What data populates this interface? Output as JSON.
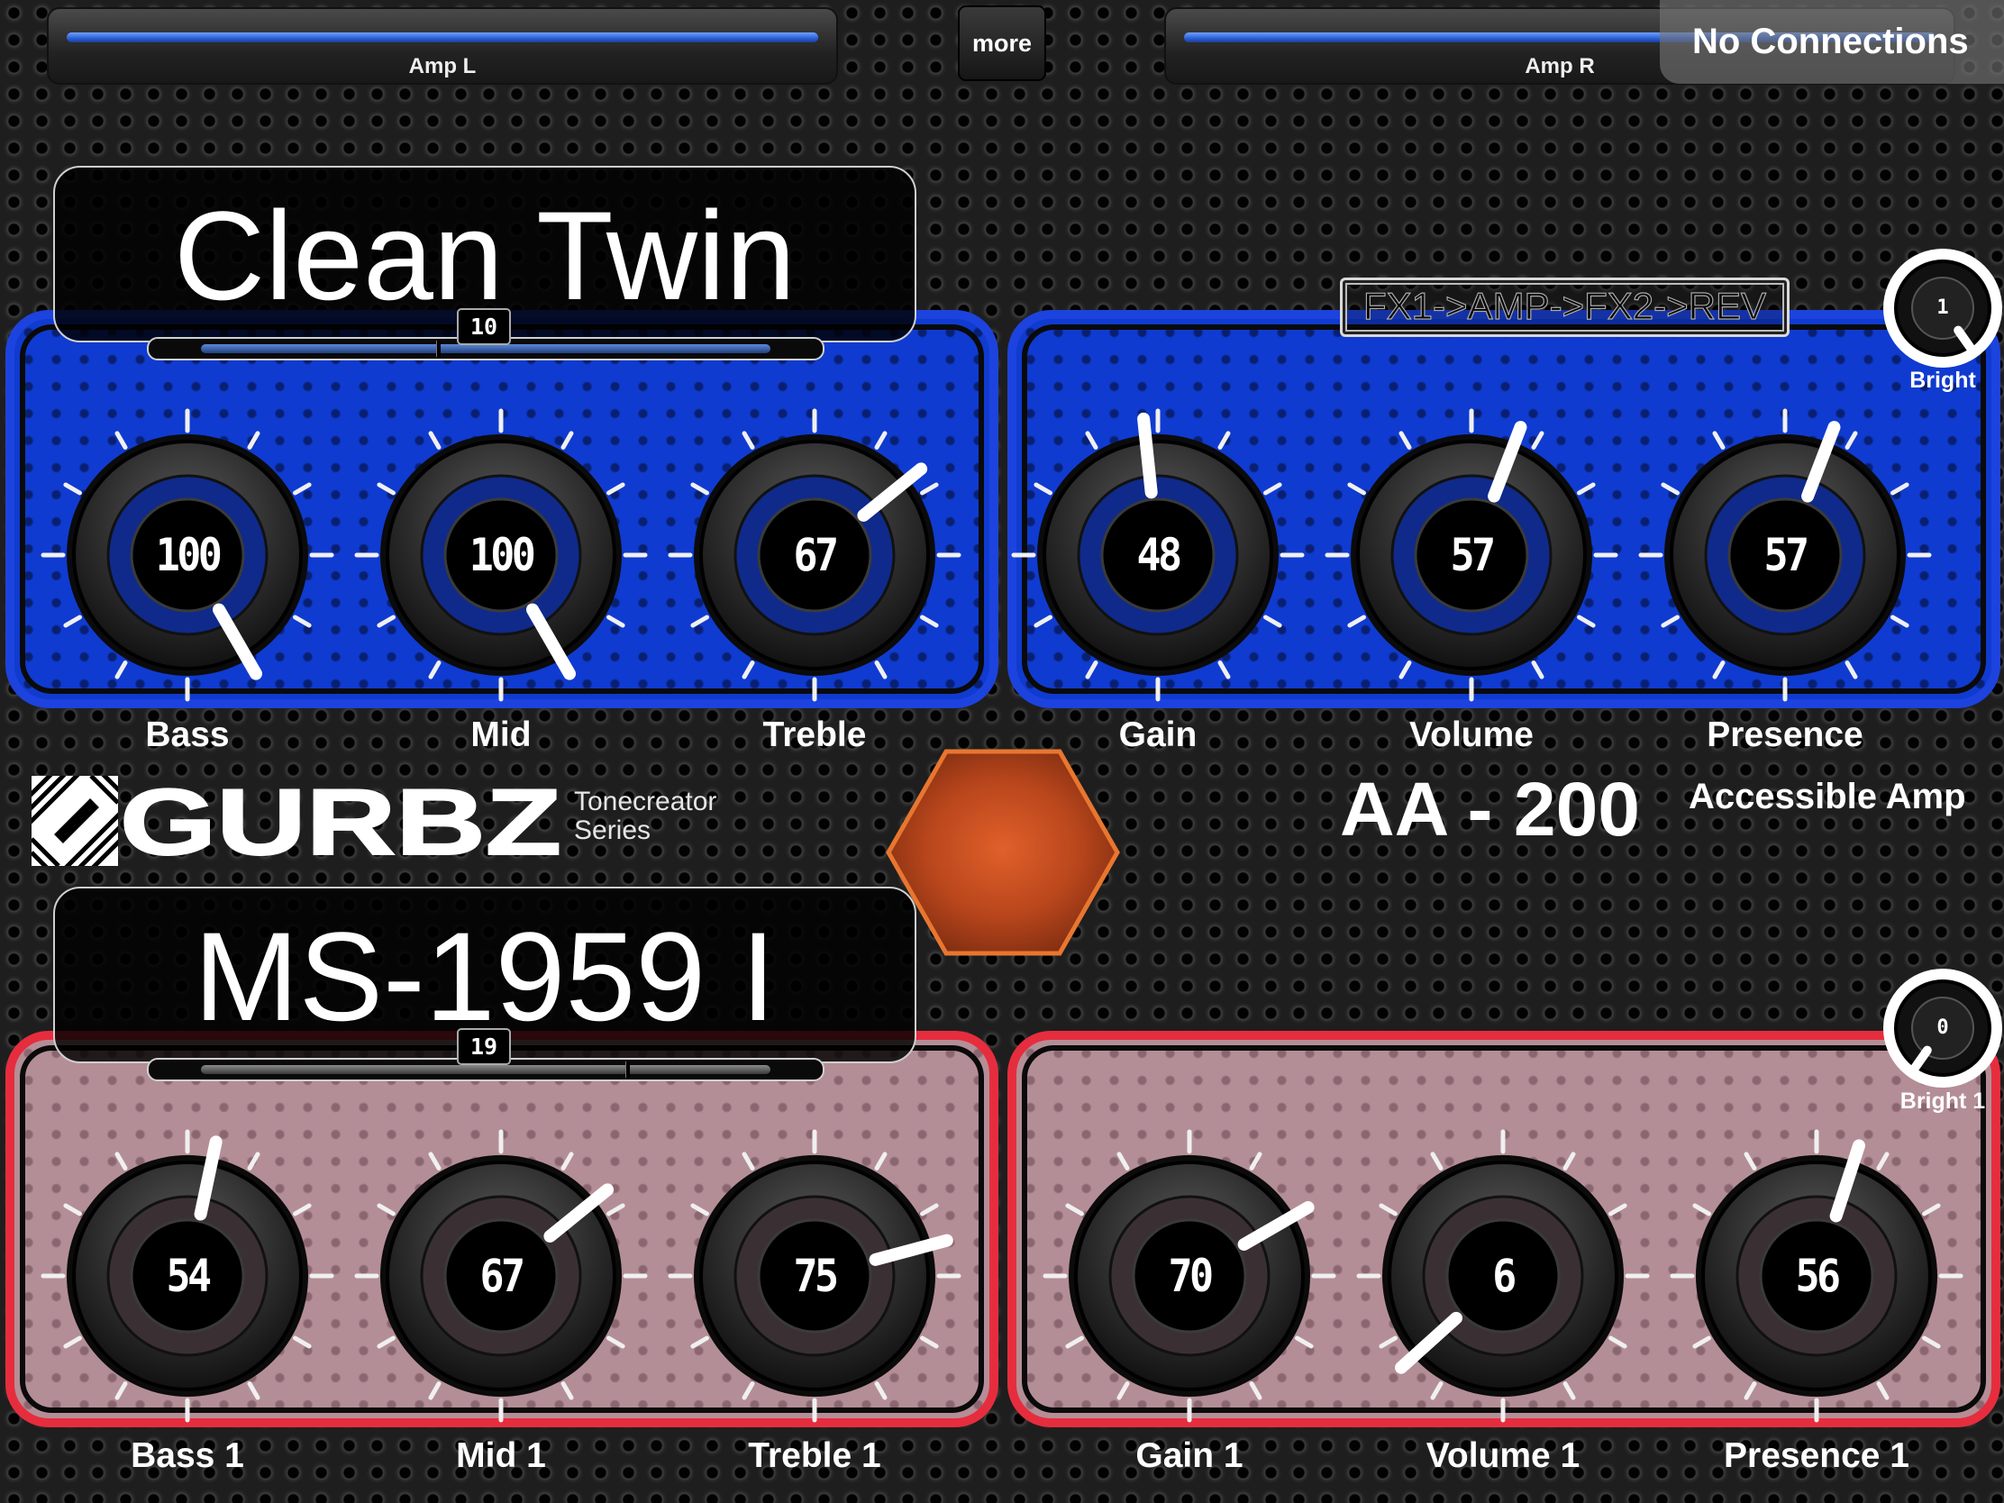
{
  "header": {
    "meter_left": {
      "label": "Amp L",
      "level": 0.98
    },
    "more_label": "more",
    "meter_right": {
      "label": "Amp R",
      "level": 0.98
    },
    "status": "No Connections"
  },
  "upper_amp": {
    "preset_name": "Clean Twin",
    "preset_number": "10",
    "preset_position": 0.41,
    "signal_chain": "FX1->AMP->FX2->REV",
    "bright": {
      "label": "Bright",
      "value": "1"
    },
    "knobs": [
      {
        "label": "Bass",
        "value": "100"
      },
      {
        "label": "Mid",
        "value": "100"
      },
      {
        "label": "Treble",
        "value": "67"
      },
      {
        "label": "Gain",
        "value": "48"
      },
      {
        "label": "Volume",
        "value": "57"
      },
      {
        "label": "Presence",
        "value": "57"
      }
    ]
  },
  "branding": {
    "brand": "GURBZ",
    "series_line1": "Tonecreator",
    "series_line2": "Series",
    "model": "AA - 200",
    "tagline": "Accessible Amp"
  },
  "lower_amp": {
    "preset_name": "MS-1959 I",
    "preset_number": "19",
    "preset_position": 0.74,
    "bright": {
      "label": "Bright 1",
      "value": "0"
    },
    "knobs": [
      {
        "label": "Bass 1",
        "value": "54"
      },
      {
        "label": "Mid 1",
        "value": "67"
      },
      {
        "label": "Treble 1",
        "value": "75"
      },
      {
        "label": "Gain 1",
        "value": "70"
      },
      {
        "label": "Volume 1",
        "value": "6"
      },
      {
        "label": "Presence 1",
        "value": "56"
      }
    ]
  },
  "colors": {
    "upper_panel": "#1c43dd",
    "lower_panel": "#e62d3e",
    "meter": "#2b5fd6",
    "center_button": "#d8551c"
  },
  "icons": {
    "logo": "gurbz-logo-icon",
    "center_button": "hexagon-icon"
  }
}
